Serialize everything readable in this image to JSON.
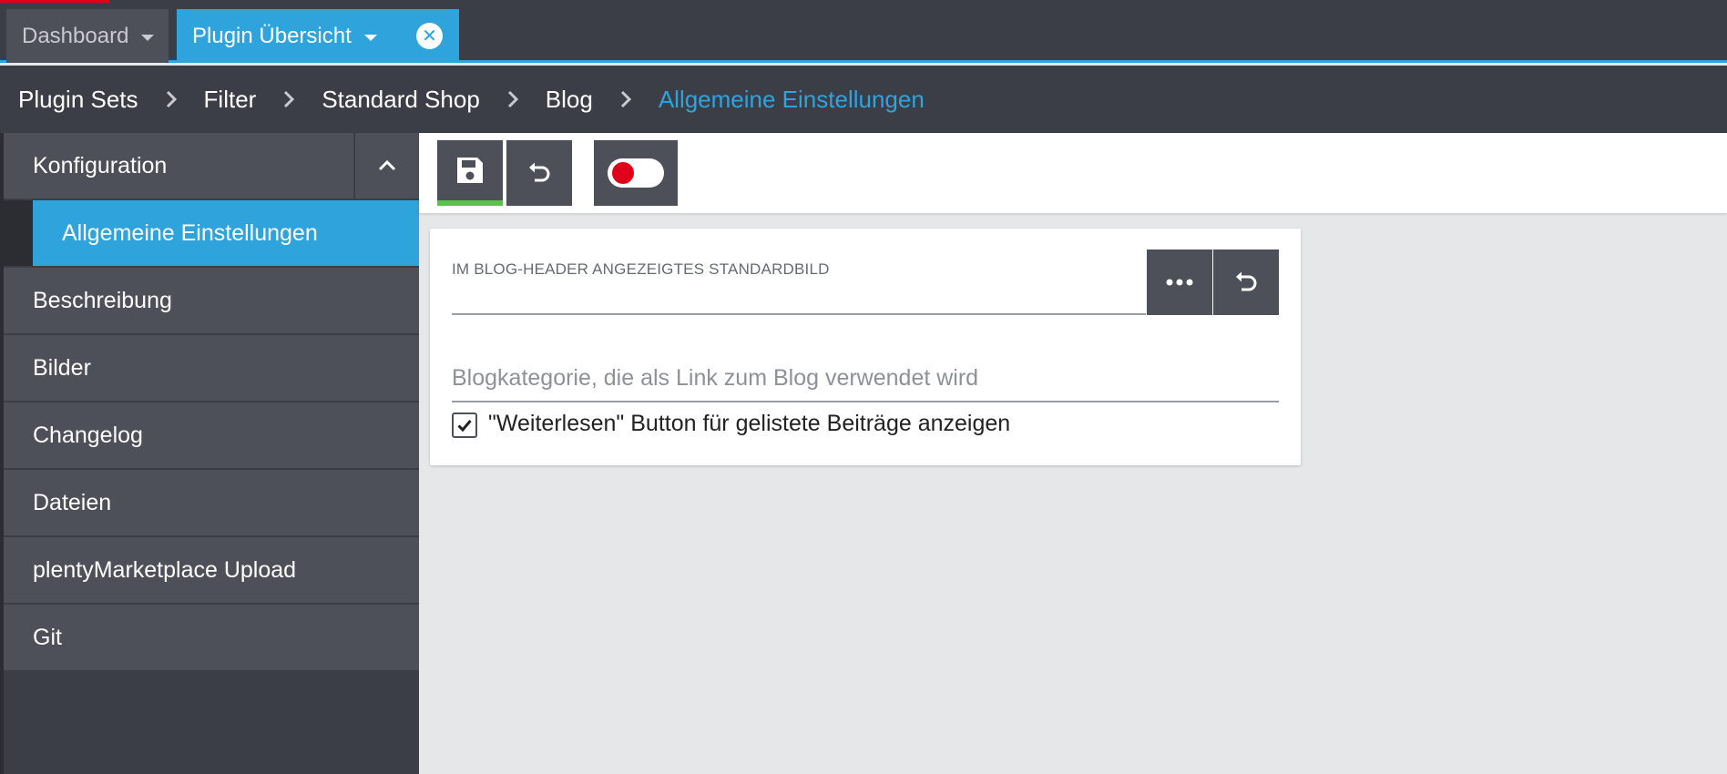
{
  "tabs": [
    {
      "label": "Dashboard"
    },
    {
      "label": "Plugin Übersicht"
    }
  ],
  "breadcrumb": [
    "Plugin Sets",
    "Filter",
    "Standard Shop",
    "Blog",
    "Allgemeine Einstellungen"
  ],
  "sidebar": {
    "header": "Konfiguration",
    "active_sub": "Allgemeine Einstellungen",
    "items": [
      "Beschreibung",
      "Bilder",
      "Changelog",
      "Dateien",
      "plentyMarketplace Upload",
      "Git"
    ]
  },
  "toolbar": {
    "save_icon": "floppy-disk-icon",
    "undo_icon": "undo-icon",
    "toggle_state": "off"
  },
  "form": {
    "image_field_label": "IM BLOG-HEADER ANGEZEIGTES STANDARDBILD",
    "image_field_value": "",
    "category_placeholder": "Blogkategorie, die als Link zum Blog verwendet wird",
    "readmore_label": "\"Weiterlesen\" Button für gelistete Beiträge anzeigen",
    "readmore_checked": true
  },
  "colors": {
    "accent": "#2fa4dc",
    "dark": "#3b3e47",
    "button": "#4d5059",
    "save_indicator": "#5ac14a",
    "toggle_off": "#e1001a"
  }
}
